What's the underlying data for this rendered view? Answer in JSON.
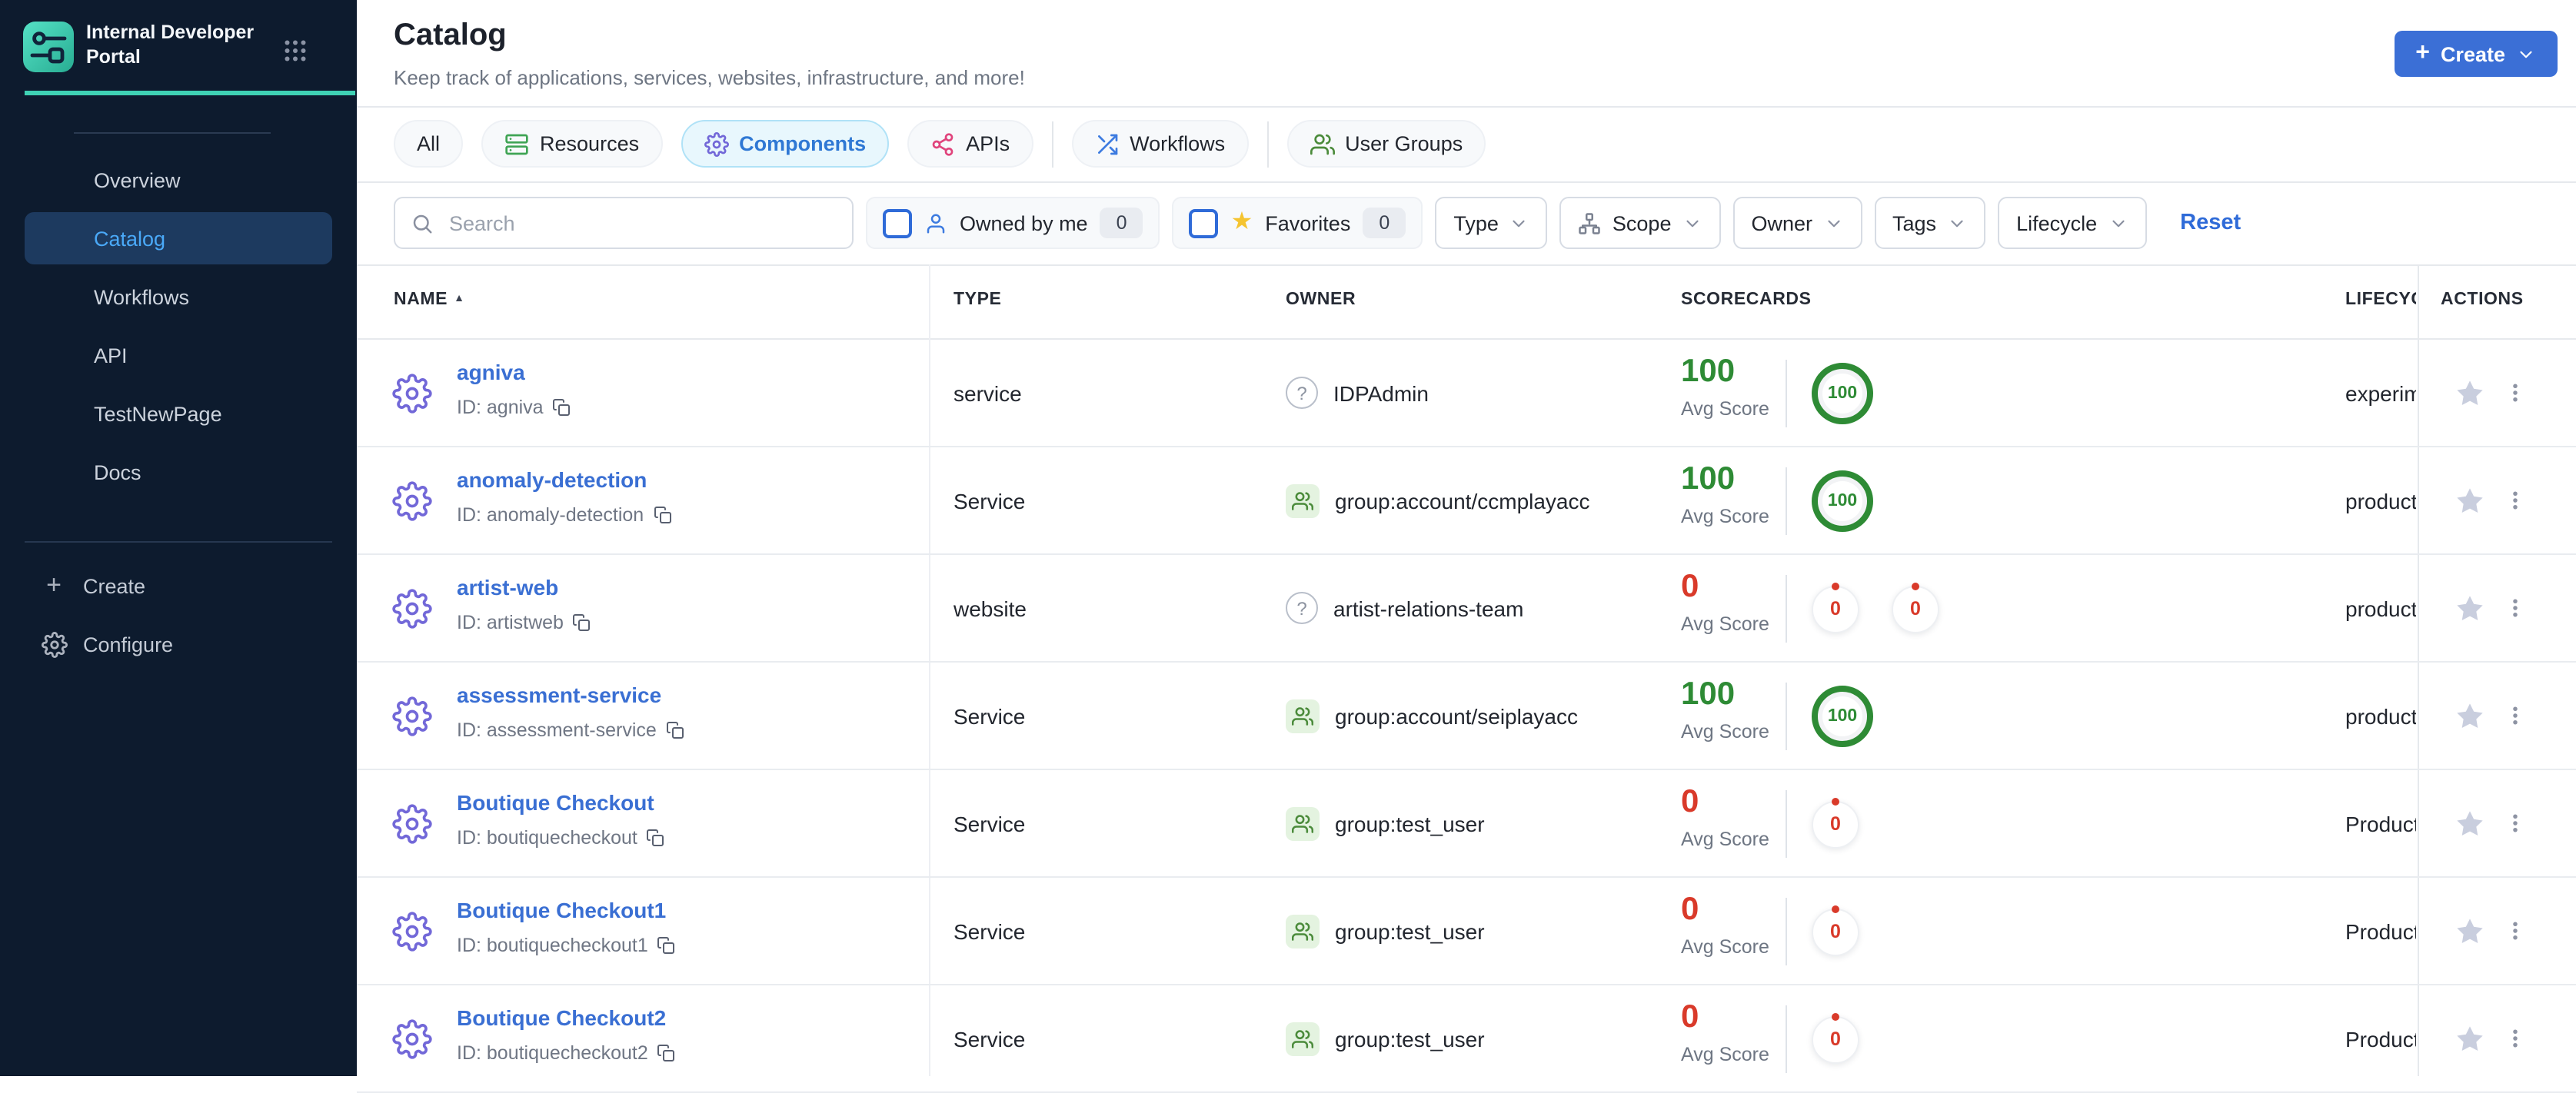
{
  "app": {
    "brand": "Internal Developer Portal"
  },
  "sidebar": {
    "items": [
      {
        "label": "Overview",
        "active": false
      },
      {
        "label": "Catalog",
        "active": true
      },
      {
        "label": "Workflows",
        "active": false
      },
      {
        "label": "API",
        "active": false
      },
      {
        "label": "TestNewPage",
        "active": false
      },
      {
        "label": "Docs",
        "active": false
      }
    ],
    "actions": [
      {
        "label": "Create",
        "icon": "plus"
      },
      {
        "label": "Configure",
        "icon": "gear"
      }
    ]
  },
  "header": {
    "title": "Catalog",
    "subtitle": "Keep track of applications, services, websites, infrastructure, and more!",
    "create_label": "Create"
  },
  "tabs": [
    {
      "label": "All",
      "icon": null,
      "active": false,
      "divider_after": false
    },
    {
      "label": "Resources",
      "icon": "resources",
      "active": false,
      "divider_after": false
    },
    {
      "label": "Components",
      "icon": "gear",
      "active": true,
      "divider_after": false
    },
    {
      "label": "APIs",
      "icon": "apis",
      "active": false,
      "divider_after": true
    },
    {
      "label": "Workflows",
      "icon": "workflows",
      "active": false,
      "divider_after": true
    },
    {
      "label": "User Groups",
      "icon": "users",
      "active": false,
      "divider_after": false
    }
  ],
  "filters": {
    "search_placeholder": "Search",
    "owned_by_me": {
      "label": "Owned by me",
      "count": "0"
    },
    "favorites": {
      "label": "Favorites",
      "count": "0"
    },
    "dropdowns": [
      {
        "label": "Type",
        "icon": null
      },
      {
        "label": "Scope",
        "icon": "scope"
      },
      {
        "label": "Owner",
        "icon": null
      },
      {
        "label": "Tags",
        "icon": null
      },
      {
        "label": "Lifecycle",
        "icon": null
      }
    ],
    "reset_label": "Reset"
  },
  "table": {
    "columns": [
      "NAME",
      "TYPE",
      "OWNER",
      "SCORECARDS",
      "LIFECYCLE",
      "ACTIONS"
    ],
    "sorted_column": "NAME",
    "sort_direction": "asc",
    "avg_score_label": "Avg Score",
    "rows": [
      {
        "name": "agniva",
        "id": "ID: agniva",
        "type": "service",
        "owner": {
          "icon": "question",
          "label": "IDPAdmin"
        },
        "score": {
          "value": "100",
          "color": "green"
        },
        "rings": [
          "100"
        ],
        "lifecycle": "experimental"
      },
      {
        "name": "anomaly-detection",
        "id": "ID: anomaly-detection",
        "type": "Service",
        "owner": {
          "icon": "group",
          "label": "group:account/ccmplayacc"
        },
        "score": {
          "value": "100",
          "color": "green"
        },
        "rings": [
          "100"
        ],
        "lifecycle": "production"
      },
      {
        "name": "artist-web",
        "id": "ID: artistweb",
        "type": "website",
        "owner": {
          "icon": "question",
          "label": "artist-relations-team"
        },
        "score": {
          "value": "0",
          "color": "red"
        },
        "rings": [
          "0",
          "0"
        ],
        "lifecycle": "production"
      },
      {
        "name": "assessment-service",
        "id": "ID: assessment-service",
        "type": "Service",
        "owner": {
          "icon": "group",
          "label": "group:account/seiplayacc"
        },
        "score": {
          "value": "100",
          "color": "green"
        },
        "rings": [
          "100"
        ],
        "lifecycle": "production"
      },
      {
        "name": "Boutique Checkout",
        "id": "ID: boutiquecheckout",
        "type": "Service",
        "owner": {
          "icon": "group",
          "label": "group:test_user"
        },
        "score": {
          "value": "0",
          "color": "red"
        },
        "rings": [
          "0"
        ],
        "lifecycle": "Production"
      },
      {
        "name": "Boutique Checkout1",
        "id": "ID: boutiquecheckout1",
        "type": "Service",
        "owner": {
          "icon": "group",
          "label": "group:test_user"
        },
        "score": {
          "value": "0",
          "color": "red"
        },
        "rings": [
          "0"
        ],
        "lifecycle": "Production"
      },
      {
        "name": "Boutique Checkout2",
        "id": "ID: boutiquecheckout2",
        "type": "Service",
        "owner": {
          "icon": "group",
          "label": "group:test_user"
        },
        "score": {
          "value": "0",
          "color": "red"
        },
        "rings": [
          "0"
        ],
        "lifecycle": "Production"
      }
    ]
  },
  "colors": {
    "sidebar_bg": "#0d1b2e",
    "accent_teal": "#3fd2b4",
    "active_nav_text": "#4aa9f8",
    "active_nav_bg": "#1d3a5f",
    "primary_button_blue": "#3b6fd6",
    "link_blue": "#3a6fd3",
    "selected_tab_bg": "#e8f7fd",
    "selected_tab_text": "#2f78d4",
    "success_green": "#2e8b35",
    "danger_red": "#d93a2a",
    "resources_icon_green": "#3fa454",
    "apis_icon_pink": "#e0447c",
    "workflows_icon_blue": "#3d7be0",
    "users_icon_green": "#4b8b3b",
    "component_gear_purple": "#7268d8",
    "favorite_star_yellow": "#f5c430",
    "row_star_gray": "#c9cede"
  }
}
